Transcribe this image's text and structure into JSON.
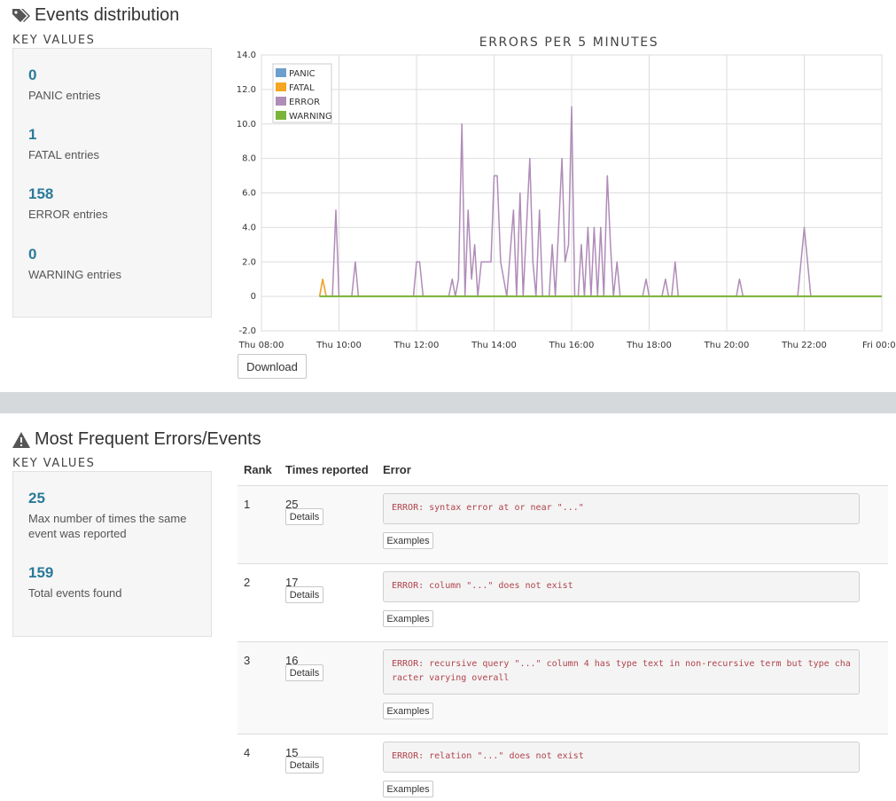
{
  "events": {
    "title": "Events distribution",
    "key_values_label": "KEY VALUES",
    "items": [
      {
        "value": "0",
        "label": "PANIC entries"
      },
      {
        "value": "1",
        "label": "FATAL entries"
      },
      {
        "value": "158",
        "label": "ERROR entries"
      },
      {
        "value": "0",
        "label": "WARNING entries"
      }
    ],
    "download_label": "Download"
  },
  "chart_data": {
    "type": "line",
    "title": "ERRORS PER 5 MINUTES",
    "x_ticks": [
      "Thu 08:00",
      "Thu 10:00",
      "Thu 12:00",
      "Thu 14:00",
      "Thu 16:00",
      "Thu 18:00",
      "Thu 20:00",
      "Thu 22:00",
      "Fri 00:00"
    ],
    "y_ticks": [
      "14.0",
      "12.0",
      "10.0",
      "8.0",
      "6.0",
      "4.0",
      "2.0",
      "0",
      "-2.0"
    ],
    "xlim_hours": [
      8,
      24
    ],
    "ylim": [
      -2,
      14
    ],
    "grid": true,
    "legend_position": "top-left",
    "series": [
      {
        "name": "PANIC",
        "color": "#6d9fce",
        "points": [
          [
            9.5,
            0
          ],
          [
            24,
            0
          ]
        ]
      },
      {
        "name": "FATAL",
        "color": "#f5a623",
        "points": [
          [
            9.5,
            0
          ],
          [
            9.58,
            1
          ],
          [
            9.67,
            0
          ],
          [
            24,
            0
          ]
        ]
      },
      {
        "name": "ERROR",
        "color": "#b08cb8",
        "points": [
          [
            9.5,
            0
          ],
          [
            9.58,
            1
          ],
          [
            9.67,
            0
          ],
          [
            9.83,
            0
          ],
          [
            9.92,
            5
          ],
          [
            10,
            0
          ],
          [
            10.33,
            0
          ],
          [
            10.42,
            2
          ],
          [
            10.5,
            0
          ],
          [
            11.92,
            0
          ],
          [
            12,
            2
          ],
          [
            12.08,
            2
          ],
          [
            12.17,
            0
          ],
          [
            12.83,
            0
          ],
          [
            12.92,
            1
          ],
          [
            13,
            0
          ],
          [
            13.08,
            1
          ],
          [
            13.17,
            10
          ],
          [
            13.25,
            0
          ],
          [
            13.33,
            5
          ],
          [
            13.42,
            1
          ],
          [
            13.5,
            3
          ],
          [
            13.58,
            0
          ],
          [
            13.67,
            2
          ],
          [
            13.75,
            2
          ],
          [
            13.92,
            2
          ],
          [
            14,
            7
          ],
          [
            14.08,
            7
          ],
          [
            14.17,
            2
          ],
          [
            14.33,
            0
          ],
          [
            14.5,
            5
          ],
          [
            14.58,
            0
          ],
          [
            14.67,
            6
          ],
          [
            14.75,
            0
          ],
          [
            14.92,
            8
          ],
          [
            15,
            2
          ],
          [
            15.08,
            0
          ],
          [
            15.17,
            5
          ],
          [
            15.25,
            0
          ],
          [
            15.42,
            0
          ],
          [
            15.5,
            3
          ],
          [
            15.58,
            0
          ],
          [
            15.75,
            8
          ],
          [
            15.83,
            2
          ],
          [
            15.92,
            3
          ],
          [
            16,
            11
          ],
          [
            16.08,
            0
          ],
          [
            16.17,
            0
          ],
          [
            16.25,
            3
          ],
          [
            16.33,
            0
          ],
          [
            16.42,
            4
          ],
          [
            16.5,
            0
          ],
          [
            16.58,
            4
          ],
          [
            16.67,
            0
          ],
          [
            16.75,
            4
          ],
          [
            16.83,
            0
          ],
          [
            16.92,
            7
          ],
          [
            17,
            3
          ],
          [
            17.08,
            0
          ],
          [
            17.17,
            2
          ],
          [
            17.25,
            0
          ],
          [
            17.83,
            0
          ],
          [
            17.92,
            1
          ],
          [
            18,
            0
          ],
          [
            18.33,
            0
          ],
          [
            18.42,
            1
          ],
          [
            18.5,
            0
          ],
          [
            18.58,
            0
          ],
          [
            18.67,
            2
          ],
          [
            18.75,
            0
          ],
          [
            20.25,
            0
          ],
          [
            20.33,
            1
          ],
          [
            20.42,
            0
          ],
          [
            21.83,
            0
          ],
          [
            22,
            4
          ],
          [
            22.17,
            0
          ],
          [
            24,
            0
          ]
        ]
      },
      {
        "name": "WARNING",
        "color": "#7bb43b",
        "points": [
          [
            9.5,
            0
          ],
          [
            24,
            0
          ]
        ]
      }
    ]
  },
  "frequent": {
    "title": "Most Frequent Errors/Events",
    "key_values_label": "KEY VALUES",
    "items": [
      {
        "value": "25",
        "label": "Max number of times the same event was reported"
      },
      {
        "value": "159",
        "label": "Total events found"
      }
    ],
    "headers": {
      "rank": "Rank",
      "times": "Times reported",
      "error": "Error"
    },
    "details_label": "Details",
    "examples_label": "Examples",
    "rows": [
      {
        "rank": "1",
        "times": "25",
        "error": "ERROR: syntax error at or near \"...\""
      },
      {
        "rank": "2",
        "times": "17",
        "error": "ERROR: column \"...\" does not exist"
      },
      {
        "rank": "3",
        "times": "16",
        "error": "ERROR: recursive query \"...\" column 4 has type text in non-recursive term but type character varying overall"
      },
      {
        "rank": "4",
        "times": "15",
        "error": "ERROR: relation \"...\" does not exist"
      }
    ]
  },
  "colors": {
    "accent": "#2b7a9a",
    "error_text": "#b0434c",
    "divider": "#d6d9dc"
  },
  "icons": {
    "events_title": "tags-icon",
    "frequent_title": "warning-icon"
  }
}
